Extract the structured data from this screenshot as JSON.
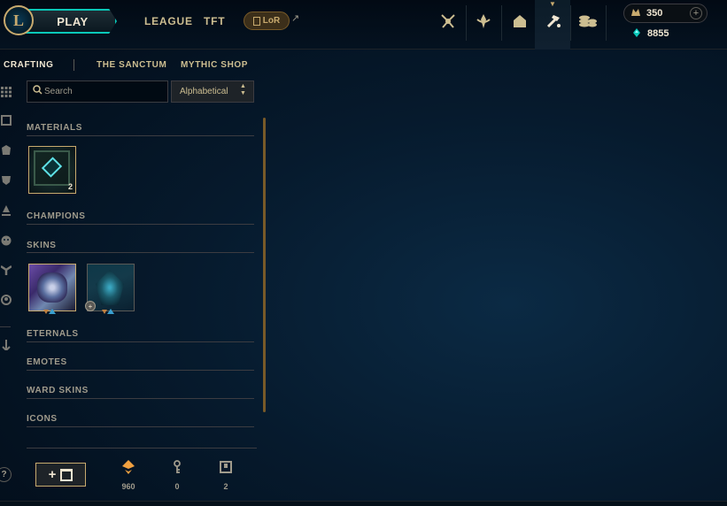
{
  "colors": {
    "gold": "#c8aa6e",
    "teal": "#0ac8b9",
    "text_light": "#f0e6d2",
    "essence_orange": "#f0a040",
    "background": "#061a2d"
  },
  "topbar": {
    "logo_text": "L",
    "play_label": "PLAY",
    "nav": [
      "LEAGUE",
      "TFT"
    ],
    "lor_label": "LoR",
    "lor_arrow": "↗",
    "icons": [
      "clash-icon",
      "missions-icon",
      "collection-icon",
      "crafting-icon",
      "store-icon"
    ],
    "rp_value": "350",
    "rp_plus": "+",
    "be_value": "8855"
  },
  "subnav": {
    "items": [
      "CRAFTING",
      "THE SANCTUM",
      "MYTHIC SHOP"
    ],
    "active": "CRAFTING"
  },
  "search": {
    "placeholder": "Search",
    "value": ""
  },
  "sort": {
    "selected": "Alphabetical"
  },
  "categories": {
    "materials": "MATERIALS",
    "champions": "CHAMPIONS",
    "skins": "SKINS",
    "eternals": "ETERNALS",
    "emotes": "EMOTES",
    "ward_skins": "WARD SKINS",
    "icons": "ICONS"
  },
  "materials": [
    {
      "name": "chest",
      "count": "2"
    }
  ],
  "footer": {
    "add_label": "+",
    "counts": [
      {
        "icon": "orange-essence-icon",
        "value": "960"
      },
      {
        "icon": "key-icon",
        "value": "0"
      },
      {
        "icon": "chest-icon",
        "value": "2"
      }
    ]
  },
  "help_label": "?"
}
